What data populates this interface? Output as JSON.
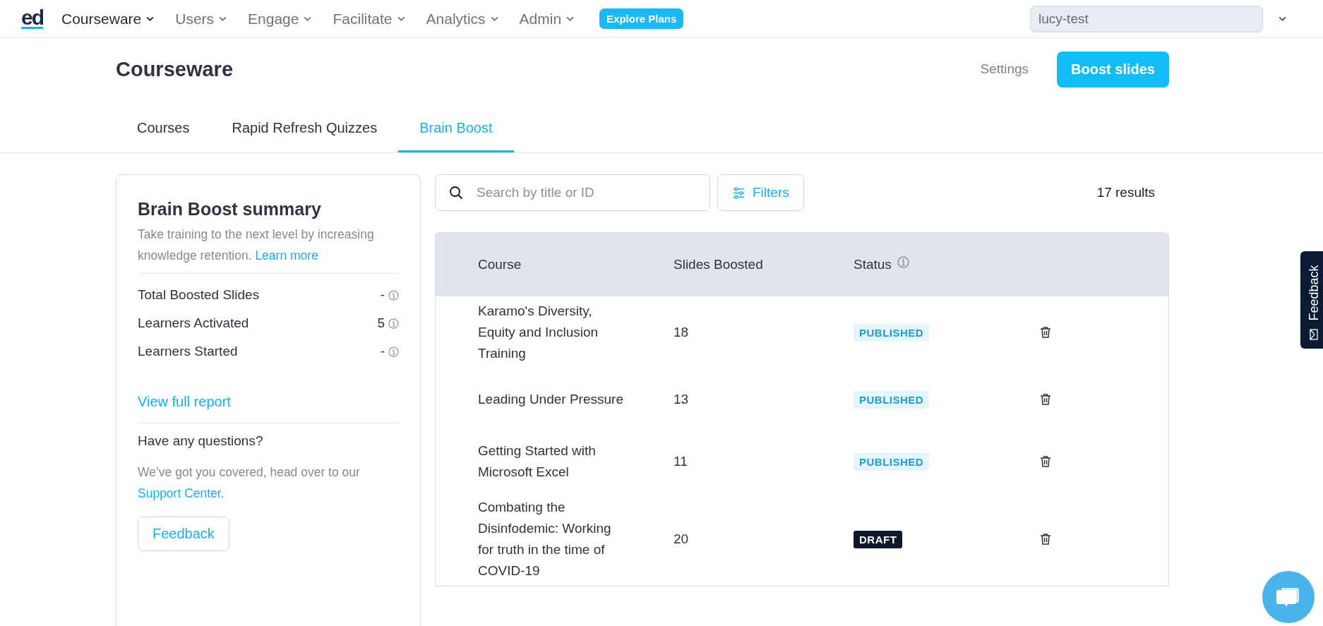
{
  "nav": {
    "logo": "ed",
    "items": [
      {
        "label": "Courseware",
        "selected": true
      },
      {
        "label": "Users",
        "selected": false
      },
      {
        "label": "Engage",
        "selected": false
      },
      {
        "label": "Facilitate",
        "selected": false
      },
      {
        "label": "Analytics",
        "selected": false
      },
      {
        "label": "Admin",
        "selected": false
      }
    ],
    "promo_button": "Explore Plans",
    "account": "lucy-test"
  },
  "page": {
    "title": "Courseware",
    "settings_link": "Settings",
    "primary_button": "Boost slides"
  },
  "tabs": [
    {
      "label": "Courses",
      "selected": false
    },
    {
      "label": "Rapid Refresh Quizzes",
      "selected": false
    },
    {
      "label": "Brain Boost",
      "selected": true
    }
  ],
  "summary": {
    "title": "Brain Boost summary",
    "description": "Take training to the next level by increasing knowledge retention.",
    "learn_more": "Learn more",
    "stats": [
      {
        "label": "Total Boosted Slides",
        "value": "-"
      },
      {
        "label": "Learners Activated",
        "value": "5"
      },
      {
        "label": "Learners Started",
        "value": "-"
      }
    ],
    "report_link": "View full report",
    "questions_title": "Have any questions?",
    "questions_text": "We’ve got you covered, head over to our",
    "support_link": "Support Center.",
    "feedback_button": "Feedback"
  },
  "search": {
    "placeholder": "Search by title or ID"
  },
  "filters_button": "Filters",
  "results": "17 results",
  "table": {
    "columns": [
      "Course",
      "Slides Boosted",
      "Status"
    ],
    "rows": [
      {
        "course": "Karamo's Diversity, Equity and Inclusion Training",
        "slides": "18",
        "status": {
          "label": "PUBLISHED",
          "kind": "published"
        }
      },
      {
        "course": "Leading Under Pressure",
        "slides": "13",
        "status": {
          "label": "PUBLISHED",
          "kind": "published"
        }
      },
      {
        "course": "Getting Started with Microsoft Excel",
        "slides": "11",
        "status": {
          "label": "PUBLISHED",
          "kind": "published"
        }
      },
      {
        "course": "Combating the Disinfodemic: Working for truth in the time of COVID-19",
        "slides": "20",
        "status": {
          "label": "DRAFT",
          "kind": "draft"
        }
      }
    ]
  },
  "feedback_tab": "Feedback"
}
